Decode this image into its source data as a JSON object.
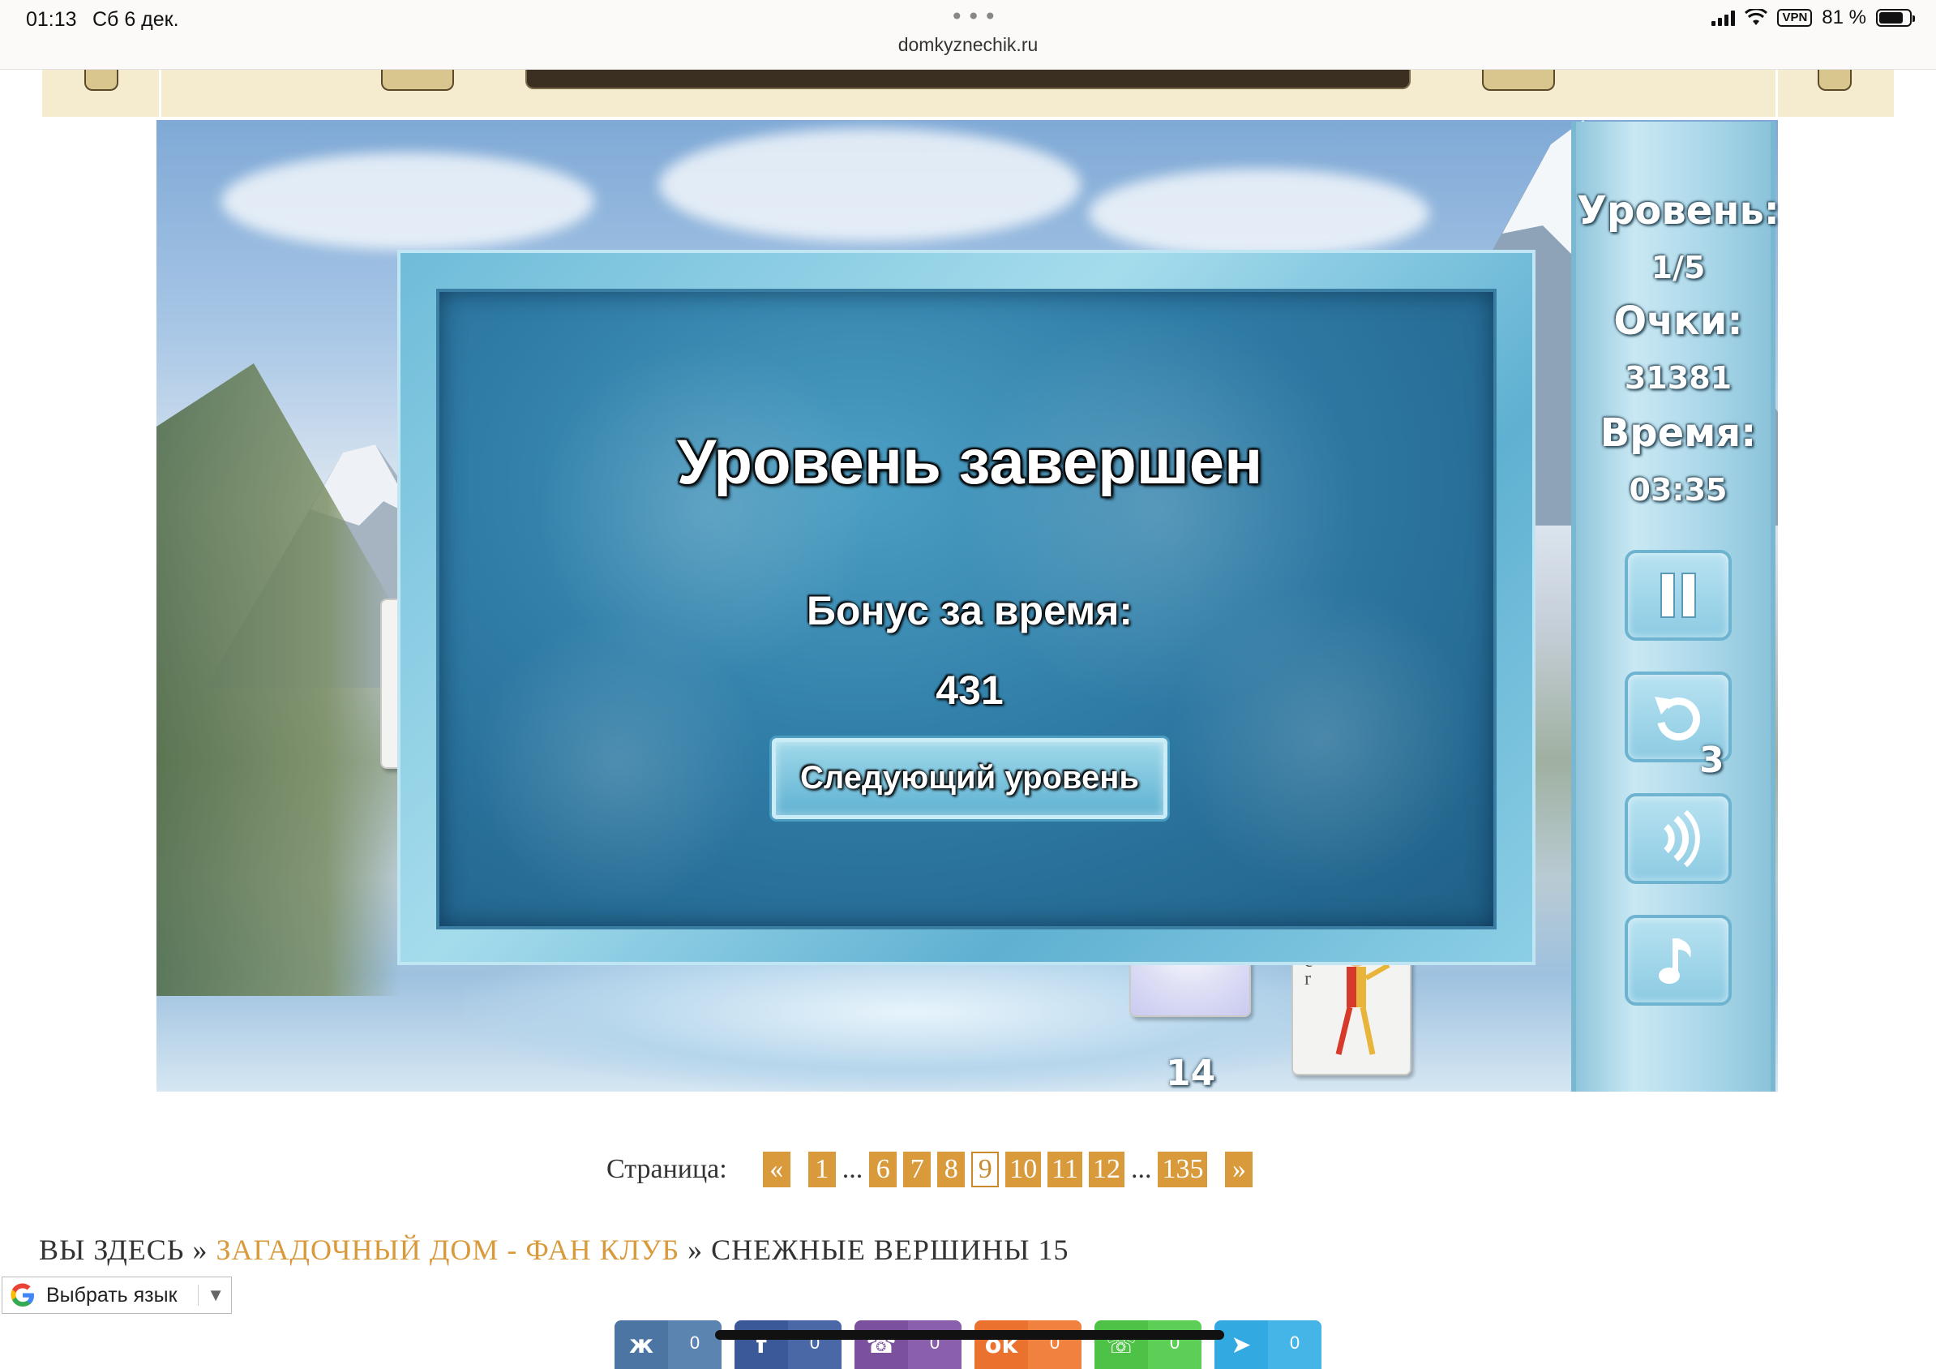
{
  "status_bar": {
    "time": "01:13",
    "date": "Сб 6 дек.",
    "url": "domkyznechik.ru",
    "vpn": "VPN",
    "battery": "81 %",
    "battery_level": 0.81
  },
  "side_panel": {
    "level_label": "Уровень:",
    "level_value": "1/5",
    "score_label": "Очки:",
    "score_value": "31381",
    "time_label": "Время:",
    "time_value": "03:35",
    "undo_count": "3",
    "buttons": [
      "pause-icon",
      "undo-icon",
      "sound-icon",
      "music-icon"
    ]
  },
  "board": {
    "tile_count": "14"
  },
  "modal": {
    "title": "Уровень завершен",
    "bonus_label": "Бонус за время:",
    "bonus_value": "431",
    "next_button": "Следующий уровень"
  },
  "pagination": {
    "label": "Страница:",
    "prev": "«",
    "next": "»",
    "ellipsis": "...",
    "pages": [
      "1",
      "6",
      "7",
      "8",
      "9",
      "10",
      "11",
      "12",
      "135"
    ],
    "current": "9"
  },
  "breadcrumb": {
    "prefix": "ВЫ ЗДЕСЬ",
    "sep": "»",
    "forum": "ЗАГАДОЧНЫЙ ДОМ - ФАН КЛУБ",
    "topic": "СНЕЖНЫЕ ВЕРШИНЫ 15"
  },
  "translate": {
    "label": "Выбрать язык",
    "caret": "▼"
  },
  "share": [
    {
      "icon": "vk-icon",
      "glyph": "ж",
      "count": "0",
      "color": "#4c75a3"
    },
    {
      "icon": "facebook-icon",
      "glyph": "f",
      "count": "0",
      "color": "#3b5998"
    },
    {
      "icon": "viber-icon",
      "glyph": "☎",
      "count": "0",
      "color": "#7b519d"
    },
    {
      "icon": "odnoklassniki-icon",
      "glyph": "ok",
      "count": "0",
      "color": "#eb722e"
    },
    {
      "icon": "whatsapp-icon",
      "glyph": "☏",
      "count": "0",
      "color": "#4dc247"
    },
    {
      "icon": "telegram-icon",
      "glyph": "➤",
      "count": "0",
      "color": "#32a9e1"
    }
  ]
}
